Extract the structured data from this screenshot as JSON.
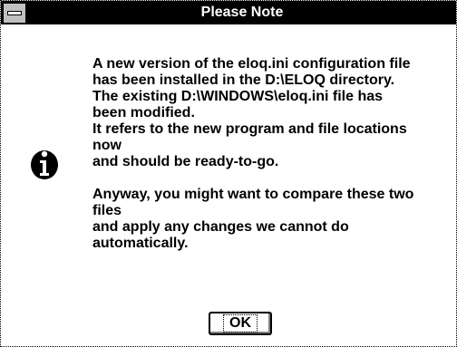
{
  "dialog": {
    "title": "Please Note",
    "icon": "info-icon",
    "message_lines": [
      "A new version of the eloq.ini configuration file",
      "has been installed in the D:\\ELOQ directory.",
      "The existing D:\\WINDOWS\\eloq.ini file has",
      "been modified.",
      "It refers to the new program and file locations",
      "now",
      "and should be ready-to-go.",
      "",
      "Anyway, you might want to compare these two",
      "files",
      "and apply any changes we cannot do",
      "automatically."
    ],
    "ok_label": "OK"
  },
  "colors": {
    "titlebar": "#000000",
    "title_text": "#ffffff",
    "background": "#ffffff"
  }
}
